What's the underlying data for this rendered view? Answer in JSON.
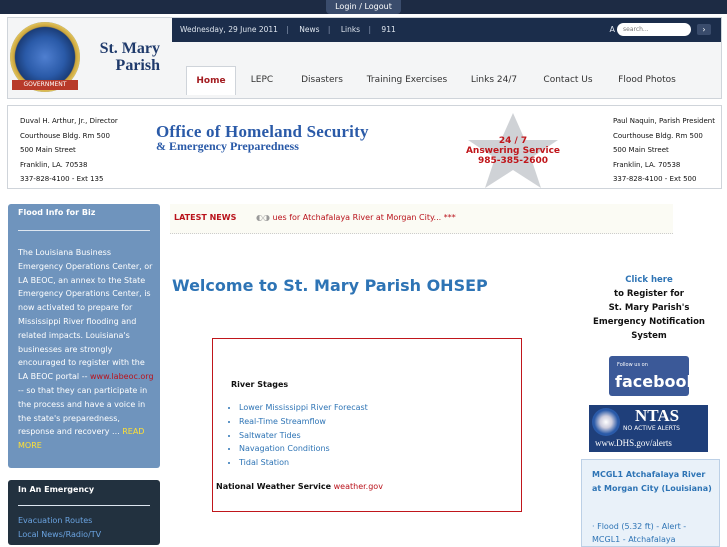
{
  "top": {
    "login_label": "Login / Logout"
  },
  "header": {
    "brand_line1": "St. Mary",
    "brand_line2": "Parish",
    "seal_text": "GOVERNMENT",
    "date": "Wednesday, 29 June 2011",
    "top_links": [
      "News",
      "Links",
      "911"
    ],
    "font_sizes": "A A A",
    "search_placeholder": "search..."
  },
  "nav": {
    "items": [
      "Home",
      "LEPC",
      "Disasters",
      "Training Exercises",
      "Links 24/7",
      "Contact Us",
      "Flood Photos"
    ],
    "active": "Home"
  },
  "info": {
    "left": [
      "Duval H. Arthur, Jr., Director",
      "Courthouse Bldg. Rm 500",
      "500 Main Street",
      "Franklin, LA. 70538",
      "337-828-4100 - Ext 135"
    ],
    "title": "Office of Homeland Security",
    "subtitle": "& Emergency Preparedness",
    "service": [
      "24 / 7",
      "Answering Service",
      "985-385-2600"
    ],
    "right": [
      "Paul Naquin, Parish President",
      "Courthouse Bldg. Rm 500",
      "500 Main Street",
      "Franklin, LA. 70538",
      "337-828-4100 - Ext 500"
    ]
  },
  "flood_box": {
    "title": "Flood Info for Biz",
    "body_before": "The Louisiana Business Emergency Operations Center, or LA BEOC, an annex to the State Emergency Operations Center, is now activated to prepare for Mississippi River flooding and related impacts. Louisiana's businesses are strongly encouraged to register with the LA BEOC portal --",
    "link": "www.labeoc.org",
    "body_after": "-- so that they can participate in the process and have a voice in the state's preparedness, response and recovery ...",
    "read_more": "READ MORE"
  },
  "emergency_box": {
    "title": "In An Emergency",
    "links": [
      "Evacuation Routes",
      "Local News/Radio/TV"
    ]
  },
  "latest": {
    "label": "LATEST NEWS",
    "text": "ues for Atchafalaya River at Morgan City... ***"
  },
  "main": {
    "welcome": "Welcome to St. Mary Parish OHSEP",
    "river_title": "River Stages",
    "river_links": [
      "Lower Mississippi River Forecast",
      "Real-Time Streamflow",
      "Saltwater Tides",
      "Navagation Conditions",
      "Tidal Station"
    ],
    "nws_label": "National Weather Service",
    "nws_link": "weather.gov"
  },
  "right": {
    "click_here": "Click here",
    "register_lines": [
      "to Register for",
      "St. Mary Parish's",
      "Emergency Notification",
      "System"
    ],
    "fb_small": "Follow us on",
    "fb_big": "facebook",
    "ntas_big": "NTAS",
    "ntas_small": "NO ACTIVE ALERTS",
    "ntas_url": "www.DHS.gov/alerts",
    "gauge_title": "MCGL1 Atchafalaya River at Morgan City (Louisiana)",
    "gauge_item": "Flood (5.32 ft) - Alert - MCGL1 - Atchafalaya"
  },
  "colors": {
    "accent_blue": "#2e74b5",
    "accent_red": "#b9121b",
    "topbar": "#1d2b44",
    "flood_box": "#6f94bd",
    "emergency_box": "#22313f"
  }
}
